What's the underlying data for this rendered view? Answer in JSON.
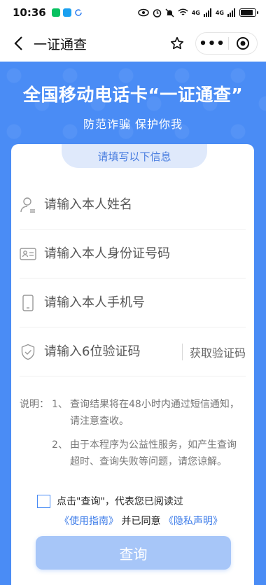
{
  "status_bar": {
    "time": "10:36",
    "signal_text_1": "4G",
    "signal_text_2": "4G",
    "battery_level": 0.9
  },
  "nav": {
    "title": "一证通查",
    "more_label": "•••"
  },
  "banner": {
    "title": "全国移动电话卡“一证通查”",
    "subtitle": "防范诈骗 保护你我"
  },
  "form": {
    "tab_label": "请填写以下信息",
    "name_placeholder": "请输入本人姓名",
    "id_placeholder": "请输入本人身份证号码",
    "phone_placeholder": "请输入本人手机号",
    "code_placeholder": "请输入6位验证码",
    "get_code_label": "获取验证码"
  },
  "notes": {
    "label": "说明：",
    "items": [
      {
        "num": "1、",
        "text": "查询结果将在48小时内通过短信通知，请注意查收。"
      },
      {
        "num": "2、",
        "text": "由于本程序为公益性服务，如产生查询超时、查询失败等问题，请您谅解。"
      }
    ]
  },
  "agreement": {
    "line1": "点击\"查询\"，代表您已阅读过",
    "guide_link": "《使用指南》",
    "connector": "并已同意",
    "privacy_link": "《隐私声明》"
  },
  "submit_label": "查询",
  "colors": {
    "primary": "#4a8cf5",
    "button_disabled": "#a7c6f8",
    "link": "#3a7ae8"
  }
}
